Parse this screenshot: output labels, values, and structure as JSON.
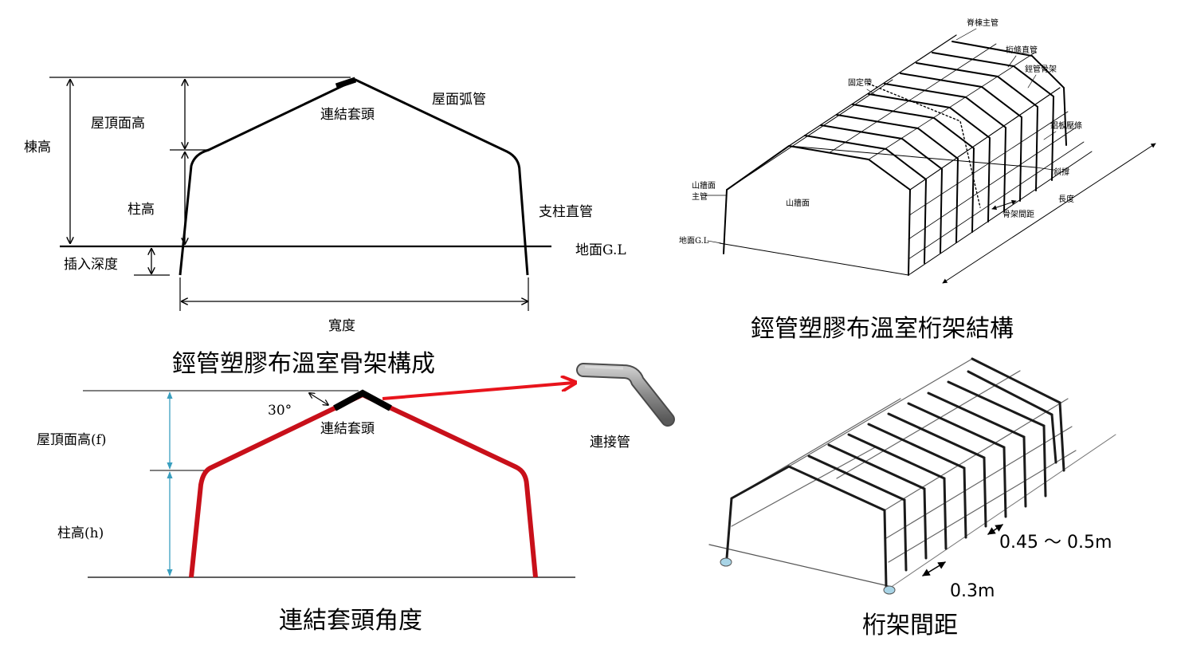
{
  "panel_frame": {
    "caption": "鋞管塑膠布溫室骨架構成",
    "labels": {
      "ridge_height": "棟高",
      "roof_height": "屋頂面高",
      "column_height": "柱高",
      "insert_depth": "插入深度",
      "joint": "連結套頭",
      "roof_pipe": "屋面弧管",
      "column_pipe": "支柱直管",
      "ground": "地面G.L",
      "width": "寬度"
    }
  },
  "panel_truss": {
    "caption": "鋞管塑膠布溫室桁架結構",
    "labels": {
      "ridge_main_pipe": "脊棟主管",
      "purlin_pipe": "桁條直管",
      "steel_frame": "鋞管骨架",
      "fixing_band": "固定帶",
      "pressing_strip": "鋁板壓條",
      "brace": "斜撐",
      "frame_spacing": "骨架間距",
      "length": "長度",
      "gable_main_line1": "山牆面",
      "gable_main_line2": "主管",
      "gable_face": "山牆面",
      "ground": "地面G.L"
    }
  },
  "panel_angle": {
    "caption": "連結套頭角度",
    "labels": {
      "roof_height": "屋頂面高(f)",
      "column_height": "柱高(h)",
      "angle": "30°",
      "joint": "連結套頭",
      "connector_pipe": "連接管"
    },
    "colors": {
      "frame": "#c8101a",
      "arrow": "#e8141c",
      "dimension": "#3a9fbf"
    }
  },
  "panel_spacing": {
    "caption": "桁架間距",
    "labels": {
      "spacing_upper": "0.45 ～ 0.5m",
      "spacing_lower": "0.3m"
    }
  }
}
